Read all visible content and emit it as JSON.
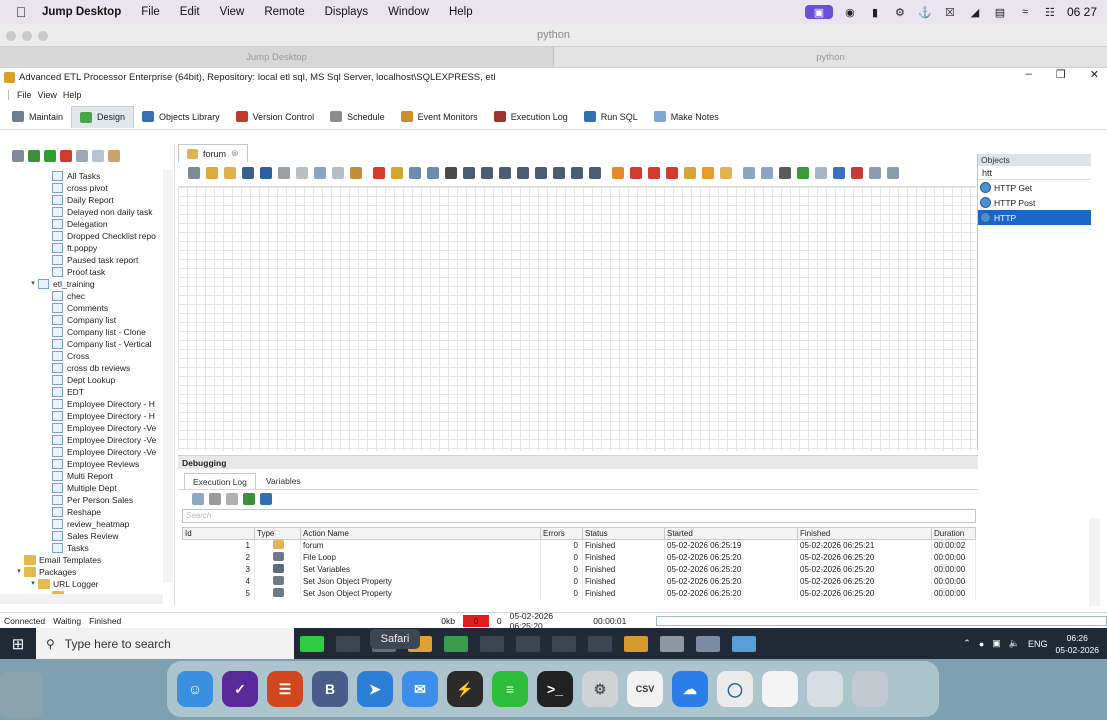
{
  "menubar": {
    "app_name": "Jump Desktop",
    "items": [
      "File",
      "Edit",
      "View",
      "Remote",
      "Displays",
      "Window",
      "Help"
    ],
    "clock": "06 27"
  },
  "jump_desktop": {
    "title": "python",
    "tabs": [
      "Jump Desktop",
      "python"
    ]
  },
  "window": {
    "title": "Advanced ETL Processor Enterprise (64bit), Repository: local etl sql, MS Sql Server, localhost\\SQLEXPRESS, etl",
    "menu": [
      "File",
      "View",
      "Help"
    ],
    "tabs": [
      {
        "label": "Maintain",
        "color": "#6e7e8f"
      },
      {
        "label": "Design",
        "color": "#4aa44a"
      },
      {
        "label": "Objects Library",
        "color": "#3470b8"
      },
      {
        "label": "Version Control",
        "color": "#c0392b"
      },
      {
        "label": "Schedule",
        "color": "#8c8c8c"
      },
      {
        "label": "Event Monitors",
        "color": "#d08b2c"
      },
      {
        "label": "Execution Log",
        "color": "#a0332f"
      },
      {
        "label": "Run SQL",
        "color": "#2f6fb3"
      },
      {
        "label": "Make Notes",
        "color": "#7ea7d8"
      }
    ]
  },
  "tree": {
    "items": [
      {
        "label": "All Tasks",
        "indent": 2,
        "kind": "doc"
      },
      {
        "label": "cross pivot",
        "indent": 2,
        "kind": "doc"
      },
      {
        "label": "Daily Report",
        "indent": 2,
        "kind": "doc"
      },
      {
        "label": "Delayed non daily task",
        "indent": 2,
        "kind": "doc"
      },
      {
        "label": "Delegation",
        "indent": 2,
        "kind": "doc"
      },
      {
        "label": "Dropped Checklist repo",
        "indent": 2,
        "kind": "doc"
      },
      {
        "label": "ft.poppy",
        "indent": 2,
        "kind": "doc"
      },
      {
        "label": "Paused task report",
        "indent": 2,
        "kind": "doc"
      },
      {
        "label": "Proof task",
        "indent": 2,
        "kind": "doc"
      },
      {
        "label": "etl_training",
        "indent": 1,
        "kind": "doc-exp"
      },
      {
        "label": "chec",
        "indent": 2,
        "kind": "doc"
      },
      {
        "label": "Comments",
        "indent": 2,
        "kind": "doc"
      },
      {
        "label": "Company list",
        "indent": 2,
        "kind": "doc"
      },
      {
        "label": "Company list - Clone",
        "indent": 2,
        "kind": "doc"
      },
      {
        "label": "Company list - Vertical",
        "indent": 2,
        "kind": "doc"
      },
      {
        "label": "Cross",
        "indent": 2,
        "kind": "doc"
      },
      {
        "label": "cross db reviews",
        "indent": 2,
        "kind": "doc"
      },
      {
        "label": "Dept Lookup",
        "indent": 2,
        "kind": "doc"
      },
      {
        "label": "EDT",
        "indent": 2,
        "kind": "doc"
      },
      {
        "label": "Employee Directory - H",
        "indent": 2,
        "kind": "doc"
      },
      {
        "label": "Employee Directory - H",
        "indent": 2,
        "kind": "doc"
      },
      {
        "label": "Employee Directory -Ve",
        "indent": 2,
        "kind": "doc"
      },
      {
        "label": "Employee Directory -Ve",
        "indent": 2,
        "kind": "doc"
      },
      {
        "label": "Employee Directory -Ve",
        "indent": 2,
        "kind": "doc"
      },
      {
        "label": "Employee Reviews",
        "indent": 2,
        "kind": "doc"
      },
      {
        "label": "Multi Report",
        "indent": 2,
        "kind": "doc"
      },
      {
        "label": "Multiple Dept",
        "indent": 2,
        "kind": "doc"
      },
      {
        "label": "Per Person Sales",
        "indent": 2,
        "kind": "doc"
      },
      {
        "label": "Reshape",
        "indent": 2,
        "kind": "doc"
      },
      {
        "label": "review_heatmap",
        "indent": 2,
        "kind": "doc"
      },
      {
        "label": "Sales Review",
        "indent": 2,
        "kind": "doc"
      },
      {
        "label": "Tasks",
        "indent": 2,
        "kind": "doc"
      },
      {
        "label": "Email Templates",
        "indent": 0,
        "kind": "folder"
      },
      {
        "label": "Packages",
        "indent": 0,
        "kind": "folder-exp"
      },
      {
        "label": "URL Logger",
        "indent": 1,
        "kind": "folder-exp"
      },
      {
        "label": "onna",
        "indent": 2,
        "kind": "folder"
      }
    ]
  },
  "designer": {
    "doc_tab": "forum"
  },
  "objects": {
    "header": "Objects",
    "search": "htt",
    "items": [
      "HTTP Get",
      "HTTP Post",
      "HTTP"
    ],
    "selected_index": 2
  },
  "debugging": {
    "header": "Debugging",
    "tabs": [
      "Execution Log",
      "Variables"
    ],
    "search_placeholder": "Search",
    "columns": [
      "Id",
      "Type",
      "Action Name",
      "Errors",
      "Status",
      "Started",
      "Finished",
      "Duration"
    ],
    "rows": [
      {
        "id": "1",
        "action": "forum",
        "errors": "0",
        "status": "Finished",
        "started": "05-02-2026 06:25:19",
        "finished": "05-02-2026 06:25:21",
        "duration": "00:00:02"
      },
      {
        "id": "2",
        "action": "File Loop",
        "errors": "0",
        "status": "Finished",
        "started": "05-02-2026 06:25:20",
        "finished": "05-02-2026 06:25:20",
        "duration": "00:00:00"
      },
      {
        "id": "3",
        "action": "Set Variables",
        "errors": "0",
        "status": "Finished",
        "started": "05-02-2026 06:25:20",
        "finished": "05-02-2026 06:25:20",
        "duration": "00:00:00"
      },
      {
        "id": "4",
        "action": "Set Json Object Property",
        "errors": "0",
        "status": "Finished",
        "started": "05-02-2026 06:25:20",
        "finished": "05-02-2026 06:25:20",
        "duration": "00:00:00"
      },
      {
        "id": "5",
        "action": "Set Json Object Property",
        "errors": "0",
        "status": "Finished",
        "started": "05-02-2026 06:25:20",
        "finished": "05-02-2026 06:25:20",
        "duration": "00:00:00"
      }
    ]
  },
  "statusbar": {
    "connected": "Connected",
    "waiting": "Waiting",
    "finished": "Finished",
    "kb": "0kb",
    "red_value": "0",
    "count": "0",
    "datetime": "05-02-2026 06:25:20",
    "elapsed": "00:00:01"
  },
  "taskbar": {
    "search_placeholder": "Type here to search",
    "tooltip": "Safari",
    "lang": "ENG",
    "time": "06:26",
    "date": "05-02-2026"
  },
  "dock": {
    "csv_label": "CSV"
  }
}
